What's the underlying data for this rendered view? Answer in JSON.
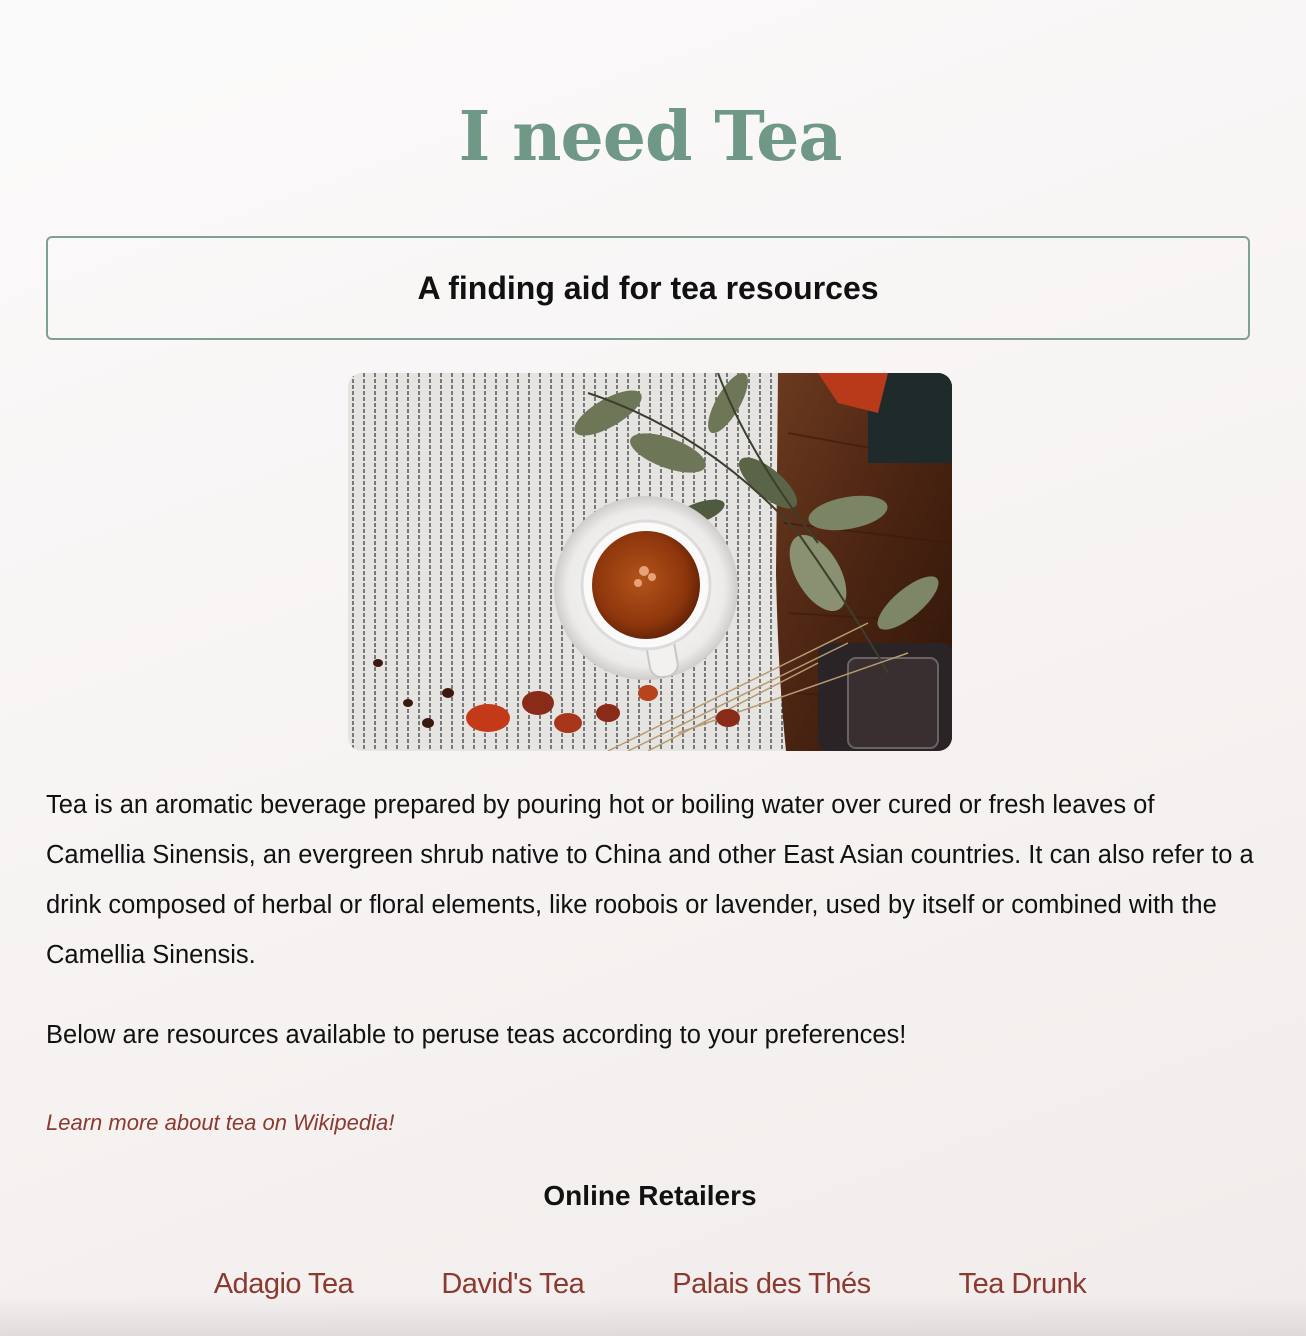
{
  "header": {
    "title": "I need Tea",
    "tagline": "A finding aid for tea resources"
  },
  "hero": {
    "image": "tea-cup-photo",
    "colors": {
      "cloth": "#e8e6e3",
      "stripe": "#3a3e44",
      "wood": "#5a2d17",
      "tea": "#9a3f0e",
      "leaf": "#6b7454"
    }
  },
  "content": {
    "intro": "Tea is an aromatic beverage prepared by pouring hot or boiling water over cured or fresh leaves of Camellia Sinensis, an evergreen shrub native to China and other East Asian countries. It can also refer to a drink composed of herbal or floral elements, like roobois or lavender, used by itself or combined with the Camellia Sinensis.",
    "resources_note": "Below are resources available to peruse teas according to your preferences!",
    "wiki_link": "Learn more about tea on Wikipedia!"
  },
  "retailers": {
    "heading": "Online Retailers",
    "links": [
      {
        "label": "Adagio Tea"
      },
      {
        "label": "David's Tea"
      },
      {
        "label": "Palais des Thés"
      },
      {
        "label": "Tea Drunk"
      }
    ]
  },
  "theme": {
    "accent": "#6f9886",
    "link": "#8b3a30",
    "text": "#111111"
  }
}
